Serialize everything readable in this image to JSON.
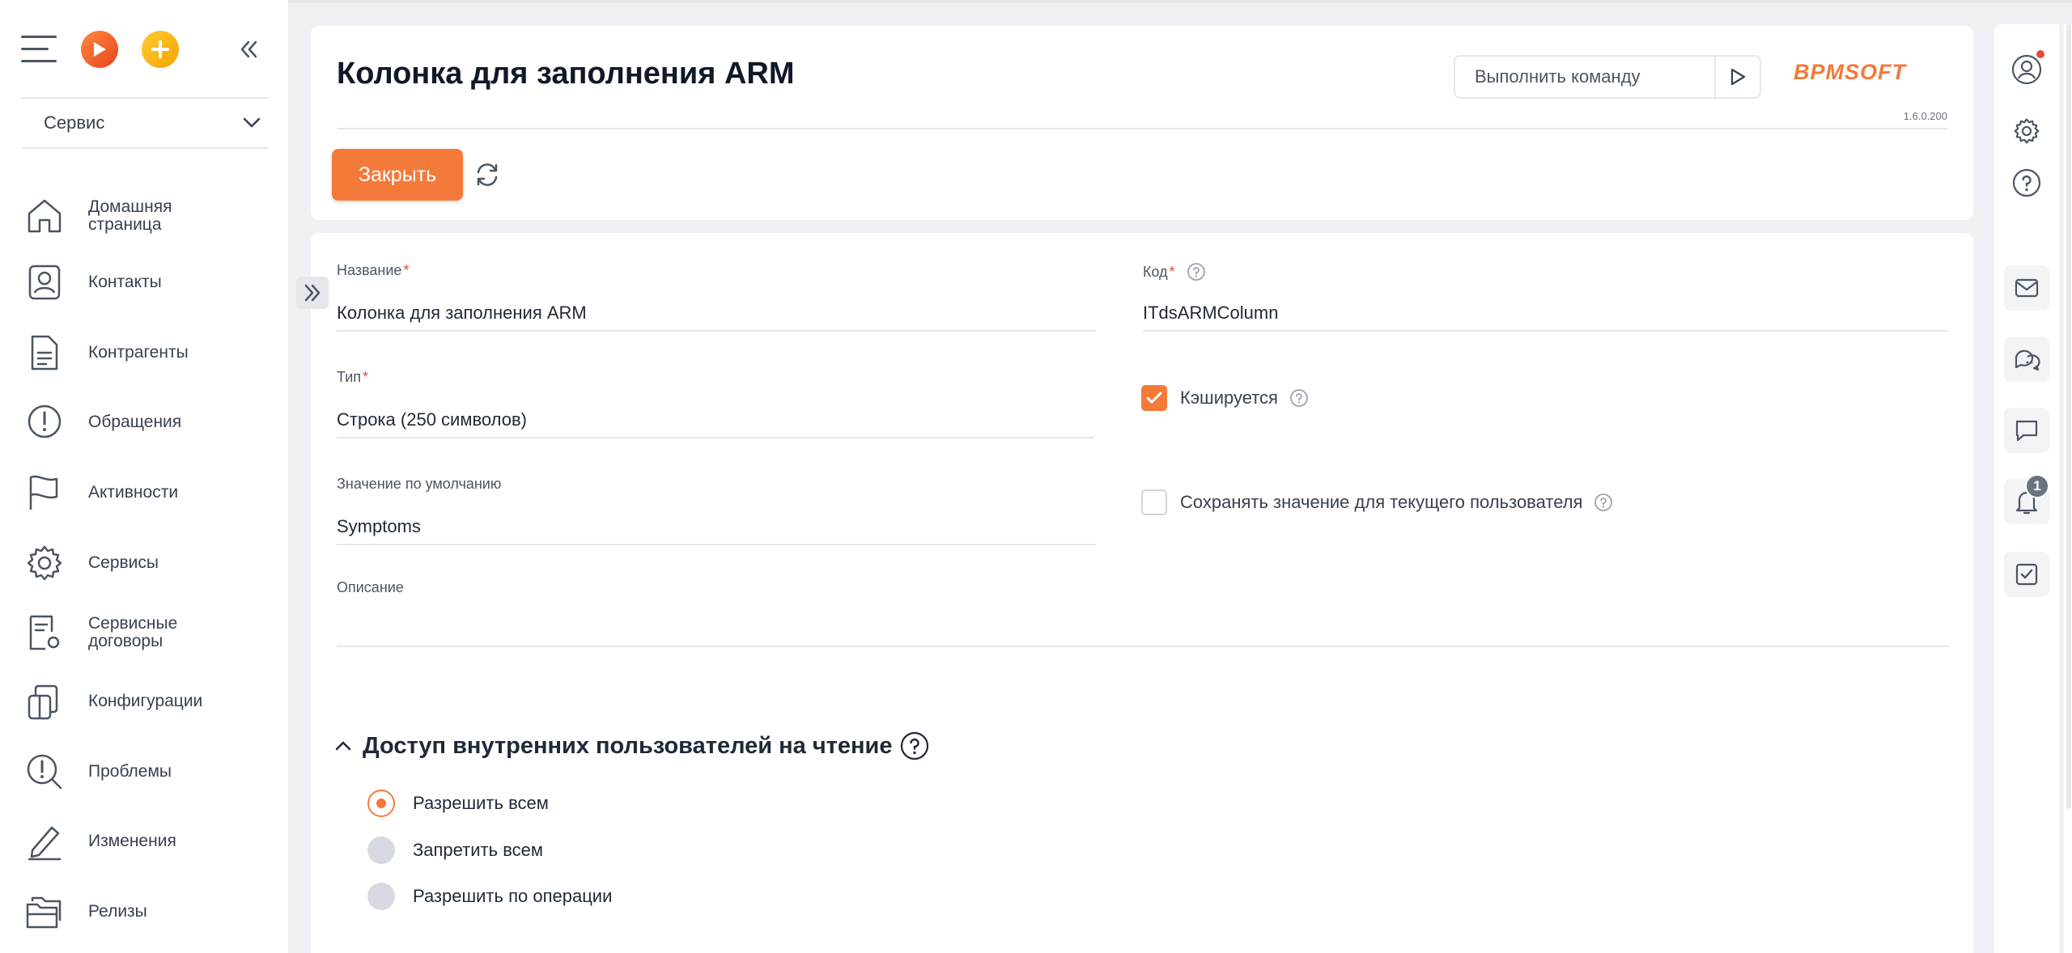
{
  "sidebar": {
    "section_select": "Сервис",
    "items": [
      {
        "label_line1": "Домашняя",
        "label_line2": "страница",
        "icon": "home-icon"
      },
      {
        "label_line1": "Контакты",
        "label_line2": "",
        "icon": "contact-icon"
      },
      {
        "label_line1": "Контрагенты",
        "label_line2": "",
        "icon": "document-icon"
      },
      {
        "label_line1": "Обращения",
        "label_line2": "",
        "icon": "alert-circle-icon"
      },
      {
        "label_line1": "Активности",
        "label_line2": "",
        "icon": "flag-icon"
      },
      {
        "label_line1": "Сервисы",
        "label_line2": "",
        "icon": "gear-icon"
      },
      {
        "label_line1": "Сервисные",
        "label_line2": "договоры",
        "icon": "contract-icon"
      },
      {
        "label_line1": "Конфигурации",
        "label_line2": "",
        "icon": "configuration-icon"
      },
      {
        "label_line1": "Проблемы",
        "label_line2": "",
        "icon": "problem-search-icon"
      },
      {
        "label_line1": "Изменения",
        "label_line2": "",
        "icon": "pencil-icon"
      },
      {
        "label_line1": "Релизы",
        "label_line2": "",
        "icon": "release-folder-icon"
      }
    ]
  },
  "header": {
    "title": "Колонка для заполнения ARM",
    "command_placeholder": "Выполнить команду",
    "brand": "BPMSOFT",
    "version": "1.6.0.200",
    "close_label": "Закрыть"
  },
  "form": {
    "name": {
      "label": "Название",
      "value": "Колонка для заполнения ARM"
    },
    "code": {
      "label": "Код",
      "value": "ITdsARMColumn"
    },
    "type": {
      "label": "Тип",
      "value": "Строка (250 символов)"
    },
    "cached": {
      "label": "Кэшируется",
      "checked": true
    },
    "default_value": {
      "label": "Значение по умолчанию",
      "value": "Symptoms"
    },
    "save_for_user": {
      "label": "Сохранять значение для текущего пользователя",
      "checked": false
    },
    "description": {
      "label": "Описание",
      "value": ""
    },
    "required_mark": "*"
  },
  "access_section": {
    "title": "Доступ внутренних пользователей на чтение",
    "options": [
      {
        "label": "Разрешить всем",
        "selected": true
      },
      {
        "label": "Запретить всем",
        "selected": false
      },
      {
        "label": "Разрешить по операции",
        "selected": false
      }
    ]
  },
  "rightbar": {
    "notification_count": "1"
  },
  "colors": {
    "accent": "#f47a3a",
    "text": "#1f2937",
    "muted": "#4b5563",
    "background": "#f0f1f5"
  }
}
